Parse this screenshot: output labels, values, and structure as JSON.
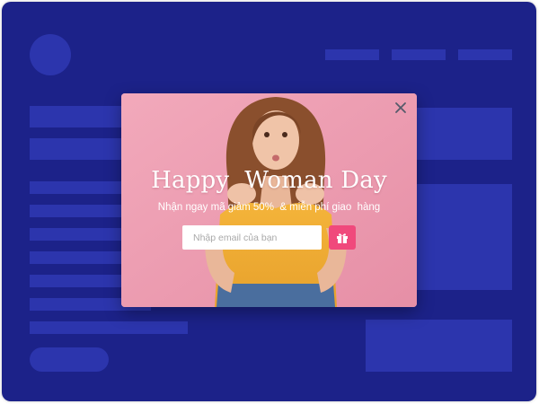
{
  "background_page": {
    "color": "#1c2289",
    "placeholder_color": "#2c35ad"
  },
  "popup": {
    "title": "Happy  Woman Day",
    "subtitle": "Nhận ngay mã giảm 50%  & miễn phí giao  hàng",
    "email_placeholder": "Nhập email của bạn",
    "email_value": "",
    "close_icon": "close-icon",
    "submit_icon": "gift-icon",
    "accent_color": "#f0497c",
    "background_color": "#eda0b3"
  }
}
